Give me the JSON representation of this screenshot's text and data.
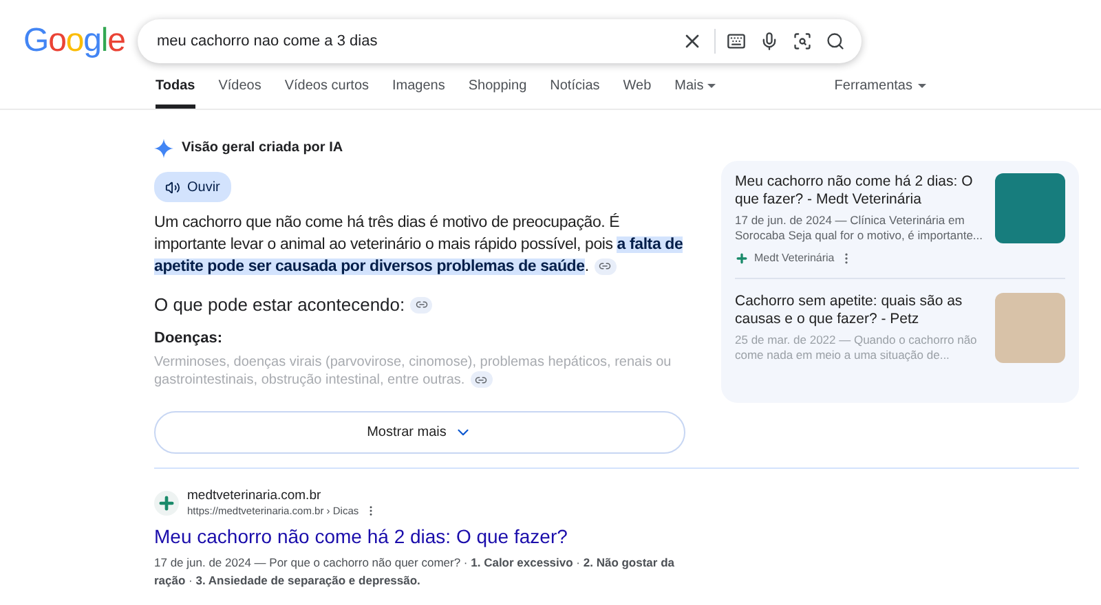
{
  "logo": "Google",
  "search": {
    "value": "meu cachorro nao come a 3 dias"
  },
  "tabs": [
    {
      "label": "Todas",
      "selected": true,
      "kind": "tab"
    },
    {
      "label": "Vídeos",
      "selected": false,
      "kind": "tab"
    },
    {
      "label": "Vídeos curtos",
      "selected": false,
      "kind": "tab"
    },
    {
      "label": "Imagens",
      "selected": false,
      "kind": "tab"
    },
    {
      "label": "Shopping",
      "selected": false,
      "kind": "tab"
    },
    {
      "label": "Notícias",
      "selected": false,
      "kind": "tab"
    },
    {
      "label": "Web",
      "selected": false,
      "kind": "tab"
    },
    {
      "label": "Mais",
      "selected": false,
      "kind": "menu"
    }
  ],
  "tools": "Ferramentas",
  "ai_overview": {
    "title": "Visão geral criada por IA",
    "listen": "Ouvir",
    "paragraph": [
      {
        "text": "Um cachorro que não come há três dias é motivo de preocupação. É importante levar o animal ao veterinário o mais rápido possível, pois ",
        "highlighted": false
      },
      {
        "text": "a falta de apetite pode ser causada por diversos problemas de saúde",
        "highlighted": true
      },
      {
        "text": ".",
        "highlighted": false
      }
    ],
    "heading": "O que pode estar acontecendo:",
    "subheading": "Doenças:",
    "faded_text": "Verminoses, doenças virais (parvovirose, cinomose), problemas hepáticos, renais ou gastrointestinais, obstrução intestinal, entre outras.",
    "show_more": "Mostrar mais",
    "sources": [
      {
        "title": "Meu cachorro não come há 2 dias: O que fazer? - Medt Veterinária",
        "snippet": "17 de jun. de 2024 — Clínica Veterinária em Sorocaba Seja qual for o motivo, é importante...",
        "site": "Medt Veterinária"
      },
      {
        "title": "Cachorro sem apetite: quais são as causas e o que fazer? - Petz",
        "snippet": "25 de mar. de 2022 — Quando o cachorro não come nada em meio a uma situação de..."
      }
    ]
  },
  "result": {
    "site": "medtveterinaria.com.br",
    "url": "https://medtveterinaria.com.br › Dicas",
    "title": "Meu cachorro não come há 2 dias: O que fazer?",
    "snippet": "17 de jun. de 2024 — Por que o cachorro não quer comer? · **1. Calor excessivo** · **2. Não gostar da ração** · **3. Ansiedade de separação e depressão.**"
  }
}
